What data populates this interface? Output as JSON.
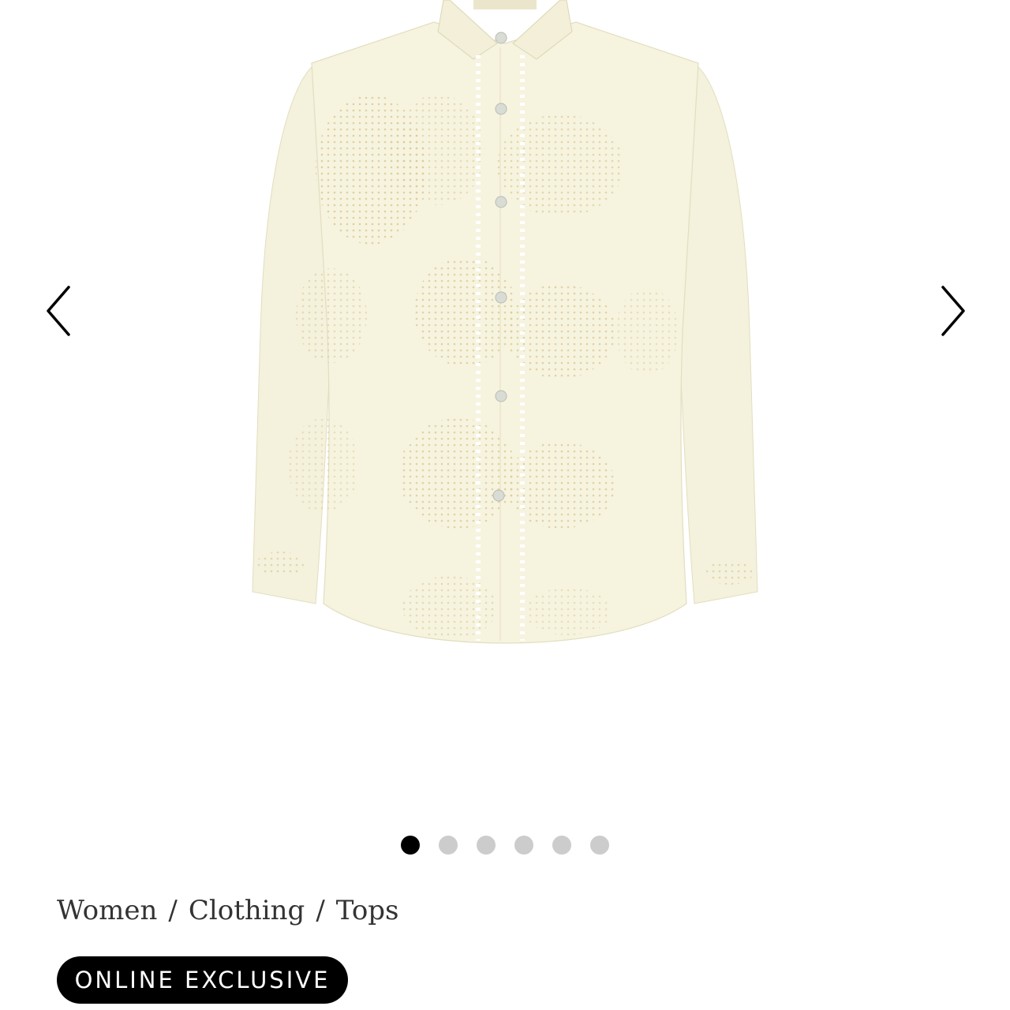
{
  "gallery": {
    "image_alt": "Cream embroidered long sleeve shirt",
    "prev_icon": "chevron-left-icon",
    "next_icon": "chevron-right-icon",
    "dots_total": 6,
    "active_index": 0
  },
  "breadcrumb": {
    "items": [
      "Women",
      "Clothing",
      "Tops"
    ],
    "separator": "/"
  },
  "badge": {
    "label": "ONLINE EXCLUSIVE"
  },
  "colors": {
    "shirt": "#f6f3df",
    "embroidery": "#e0cf9c",
    "badge_bg": "#000000",
    "dot_active": "#000000",
    "dot_inactive": "#cccccc"
  }
}
